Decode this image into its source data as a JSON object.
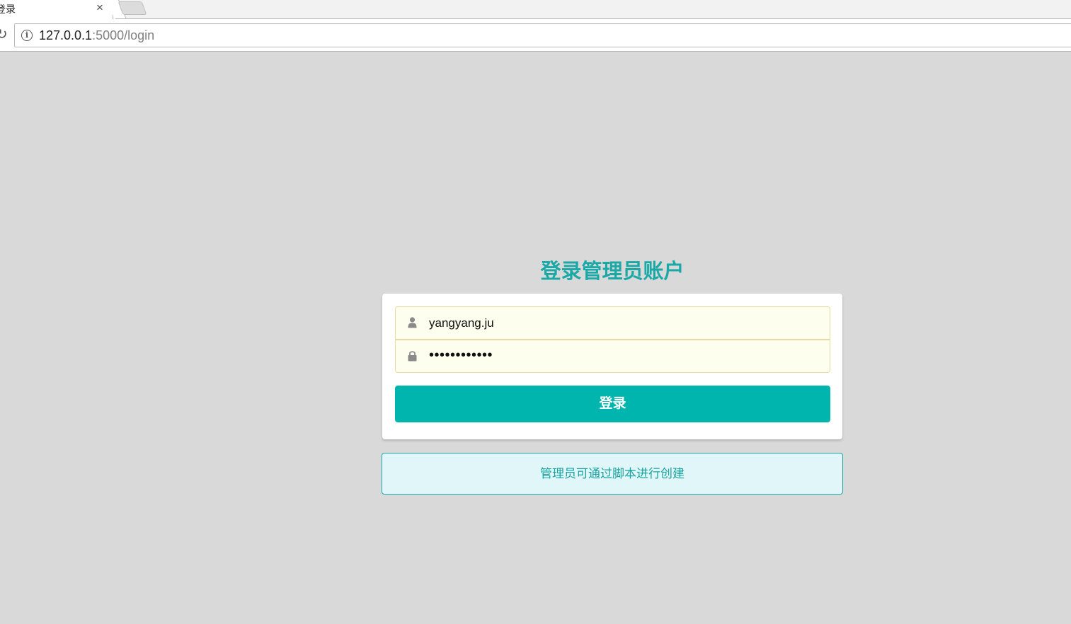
{
  "browser": {
    "tab_title": "登录",
    "tab_close": "×",
    "url_host": "127.0.0.1",
    "url_path": ":5000/login"
  },
  "page": {
    "heading": "登录管理员账户",
    "username_value": "yangyang.ju",
    "password_value": "••••••••••••",
    "login_button": "登录",
    "notice": "管理员可通过脚本进行创建"
  },
  "colors": {
    "accent": "#00b5ad",
    "heading": "#1aa9a6",
    "field_bg": "#fefeee",
    "notice_bg": "#e0f6f8",
    "page_bg": "#d9d9d9"
  },
  "icons": {
    "username": "user-icon",
    "password": "lock-icon",
    "reload": "reload-icon",
    "info": "info-icon"
  }
}
